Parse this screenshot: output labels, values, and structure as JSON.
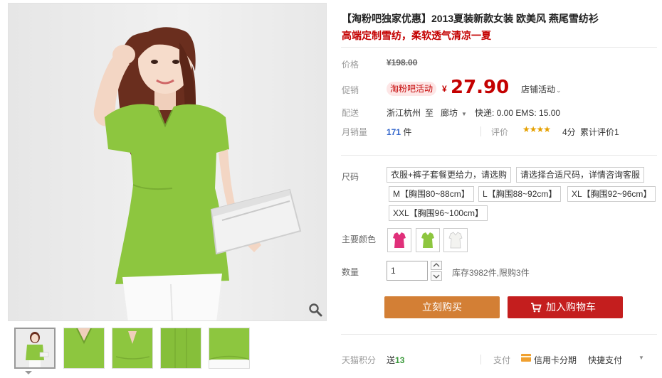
{
  "product": {
    "title": "【淘粉吧独家优惠】2013夏装新款女装 欧美风 燕尾雪纺衫",
    "subtitle": "高端定制雪纺，柔软透气清凉一夏"
  },
  "price": {
    "label": "价格",
    "original": "¥198.00"
  },
  "promo": {
    "label": "促销",
    "tag": "淘粉吧活动",
    "currency": "¥",
    "value": "27.90",
    "shop_activity": "店铺活动"
  },
  "shipping": {
    "label": "配送",
    "from": "浙江杭州",
    "to_word": "至",
    "destination": "廊坊",
    "fees": "快递: 0.00 EMS: 15.00"
  },
  "sales": {
    "label": "月销量",
    "count": "171",
    "unit": "件",
    "rating_label": "评价",
    "stars": "★★★★",
    "star_rating": 4,
    "score": "4分",
    "review_count": "累计评价1"
  },
  "size": {
    "label": "尺码",
    "options": [
      "衣服+裤子套餐更给力，请选购",
      "请选择合适尺码，详情咨询客服",
      "M【胸围80~88cm】",
      "L【胸围88~92cm】",
      "XL【胸围92~96cm】",
      "XXL【胸围96~100cm】"
    ]
  },
  "color": {
    "label": "主要颜色",
    "swatches": [
      {
        "name": "rose",
        "hex": "#e0307a"
      },
      {
        "name": "green",
        "hex": "#8dc63f"
      },
      {
        "name": "white",
        "hex": "#f3f3f0"
      }
    ]
  },
  "quantity": {
    "label": "数量",
    "value": "1",
    "stock": "库存3982件,限购3件"
  },
  "actions": {
    "buy_now": "立刻购买",
    "add_to_cart": "加入购物车"
  },
  "footer": {
    "points_label": "天猫积分",
    "points_prefix": "送",
    "points_value": "13",
    "pay_label": "支付",
    "credit_card": "信用卡分期",
    "quick_pay": "快捷支付"
  },
  "colors": {
    "price_red": "#c40000",
    "buy_orange": "#d37f35",
    "cart_red": "#c41e1e",
    "link_blue": "#3366cc",
    "blouse_green": "#8dc63f"
  }
}
